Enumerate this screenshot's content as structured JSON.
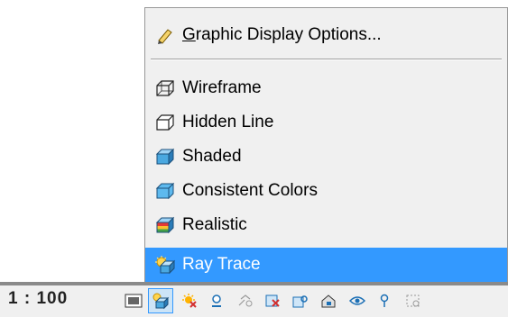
{
  "menu": {
    "items": [
      {
        "id": "graphic-display-options",
        "label": "Graphic Display Options...",
        "icon": "pencil-icon"
      },
      {
        "id": "wireframe",
        "label": "Wireframe",
        "icon": "wireframe-cube-icon"
      },
      {
        "id": "hidden-line",
        "label": "Hidden Line",
        "icon": "hidden-line-cube-icon"
      },
      {
        "id": "shaded",
        "label": "Shaded",
        "icon": "shaded-cube-icon"
      },
      {
        "id": "consistent-colors",
        "label": "Consistent Colors",
        "icon": "consistent-colors-cube-icon"
      },
      {
        "id": "realistic",
        "label": "Realistic",
        "icon": "realistic-cube-icon"
      },
      {
        "id": "ray-trace",
        "label": "Ray Trace",
        "icon": "ray-trace-icon",
        "selected": true
      }
    ]
  },
  "statusbar": {
    "scale": "1 : 100",
    "buttons": [
      "detail-level-icon",
      "visual-style-icon",
      "sun-path-icon",
      "shadows-icon",
      "rendering-dialog-icon",
      "crop-view-icon",
      "show-crop-region-icon",
      "unlock-3d-view-icon",
      "temporary-hide-isolate-icon",
      "reveal-hidden-elements-icon",
      "analytical-model-icon"
    ]
  },
  "colors": {
    "selection": "#3399ff",
    "menu_background": "#f0f0f0"
  }
}
